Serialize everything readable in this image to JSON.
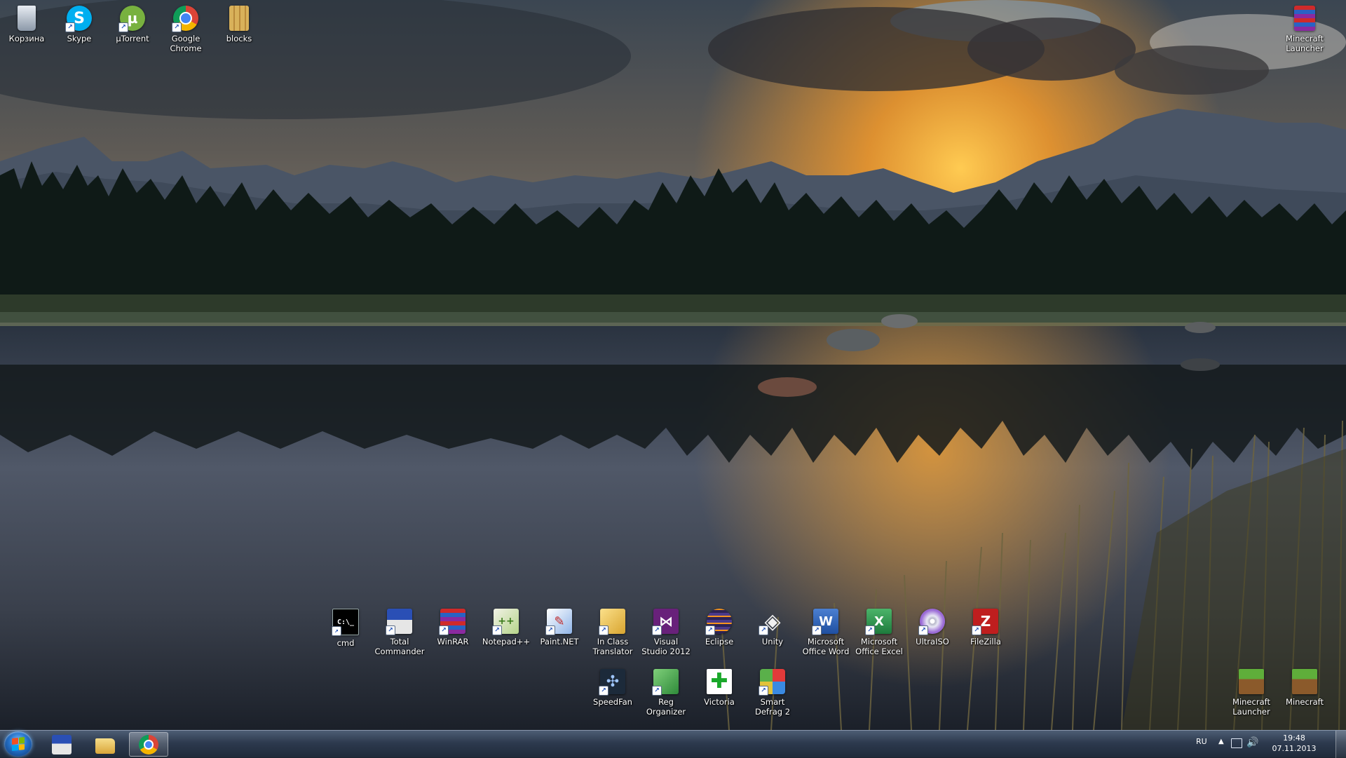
{
  "desktop": {
    "icons": {
      "recycle_bin": "Корзина",
      "skype": "Skype",
      "utorrent": "µTorrent",
      "chrome": "Google Chrome",
      "blocks": "blocks",
      "minecraft_launcher_top": "Minecraft Launcher",
      "cmd": "cmd",
      "total_commander": "Total Commander",
      "winrar": "WinRAR",
      "notepadpp": "Notepad++",
      "paintnet": "Paint.NET",
      "in_class_translator": "In Class Translator",
      "visual_studio": "Visual Studio 2012",
      "eclipse": "Eclipse",
      "unity": "Unity",
      "ms_word": "Microsoft Office Word",
      "ms_excel": "Microsoft Office Excel",
      "ultraiso": "UltraISO",
      "filezilla": "FileZilla",
      "speedfan": "SpeedFan",
      "reg_organizer": "Reg Organizer",
      "victoria": "Victoria",
      "smart_defrag": "Smart Defrag 2",
      "minecraft_launcher_bottom": "Minecraft Launcher",
      "minecraft": "Minecraft"
    }
  },
  "taskbar": {
    "pinned": [
      "start-button",
      "total-commander-icon",
      "explorer-icon",
      "chrome-icon"
    ],
    "tray": {
      "language": "RU",
      "time": "19:48",
      "date": "07.11.2013"
    }
  },
  "colors": {
    "sky_glow": "#f4a636",
    "taskbar": "#2d3a4e",
    "label_text": "#ffffff"
  }
}
